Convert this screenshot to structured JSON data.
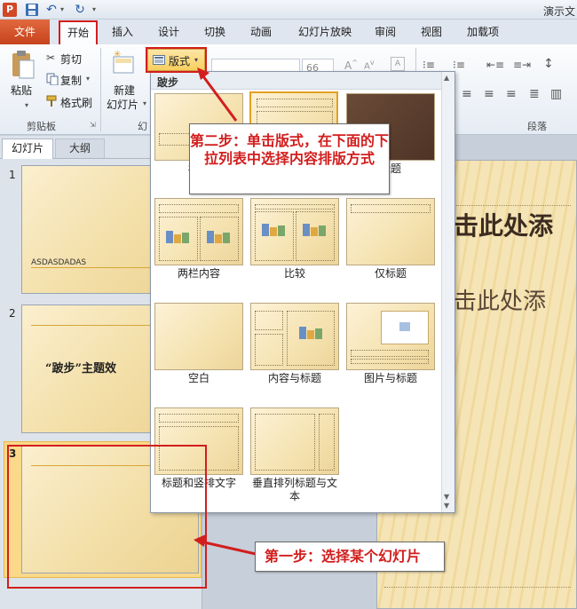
{
  "titlebar": {
    "title": "演示文",
    "app_letter": "P"
  },
  "tabs": [
    "文件",
    "开始",
    "插入",
    "设计",
    "切换",
    "动画",
    "幻灯片放映",
    "审阅",
    "视图",
    "加载项"
  ],
  "ribbon": {
    "clipboard": {
      "paste": "粘贴",
      "cut": "剪切",
      "copy": "复制",
      "format_painter": "格式刷",
      "group": "剪贴板"
    },
    "slides": {
      "new_slide": "新建",
      "new_slide_sub": "幻灯片",
      "layout": "版式",
      "group_partial": "幻"
    },
    "font_size": "66",
    "paragraph_group": "段落"
  },
  "pane_tabs": {
    "slides": "幻灯片",
    "outline": "大纲"
  },
  "slides": [
    {
      "num": "1",
      "text": "ASDASDADAS"
    },
    {
      "num": "2",
      "text": "“跛步”主题效"
    },
    {
      "num": "3",
      "text": ""
    }
  ],
  "main_slide": {
    "title": "击此处添",
    "subtitle": "击此处添"
  },
  "dropdown": {
    "header": "跛步",
    "layouts": [
      "标题",
      "",
      "标题",
      "两栏内容",
      "比较",
      "仅标题",
      "空白",
      "内容与标题",
      "图片与标题",
      "标题和竖排文字",
      "垂直排列标题与文本"
    ]
  },
  "annotations": {
    "step2": "第二步：单击版式，在下面的下拉列表中选择内容排版方式",
    "step1": "第一步：选择某个幻灯片"
  },
  "colors": {
    "file_tab": "#d24726",
    "highlight": "#d21e1e",
    "slide_bg": "#f3dfa8"
  }
}
